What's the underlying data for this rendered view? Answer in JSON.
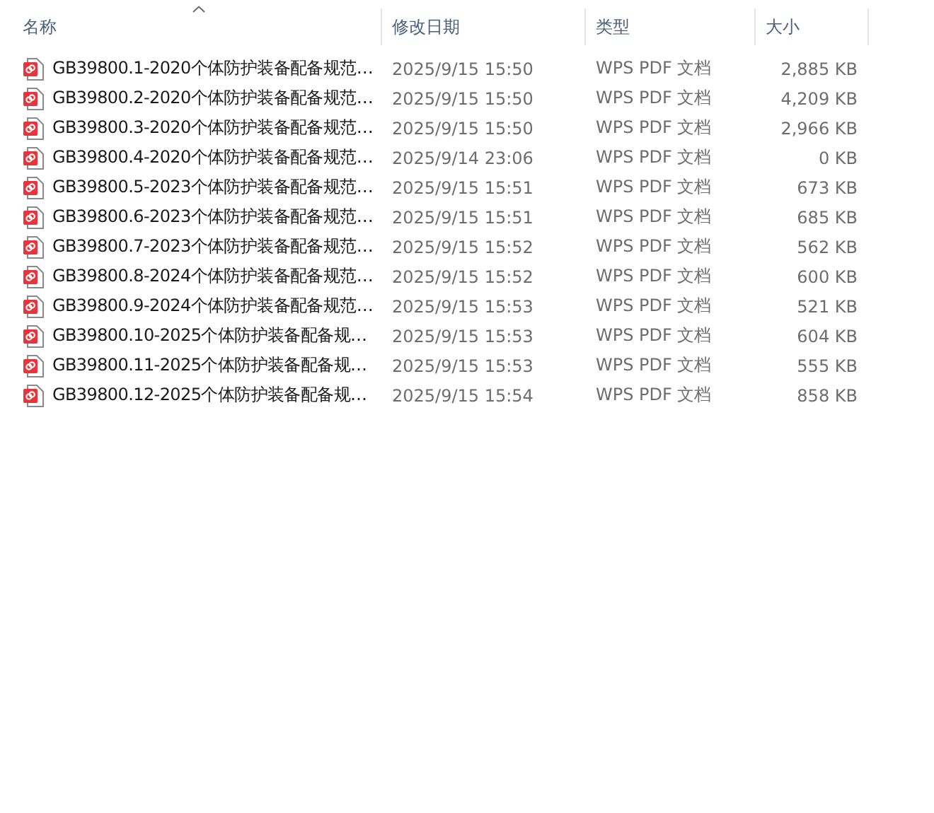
{
  "columns": [
    {
      "label": "名称",
      "sorted": true
    },
    {
      "label": "修改日期",
      "sorted": false
    },
    {
      "label": "类型",
      "sorted": false
    },
    {
      "label": "大小",
      "sorted": false
    }
  ],
  "files": [
    {
      "name": "GB39800.1-2020个体防护装备配备规范…",
      "modified": "2025/9/15 15:50",
      "type": "WPS PDF 文档",
      "size": "2,885 KB"
    },
    {
      "name": "GB39800.2-2020个体防护装备配备规范…",
      "modified": "2025/9/15 15:50",
      "type": "WPS PDF 文档",
      "size": "4,209 KB"
    },
    {
      "name": "GB39800.3-2020个体防护装备配备规范…",
      "modified": "2025/9/15 15:50",
      "type": "WPS PDF 文档",
      "size": "2,966 KB"
    },
    {
      "name": "GB39800.4-2020个体防护装备配备规范…",
      "modified": "2025/9/14 23:06",
      "type": "WPS PDF 文档",
      "size": "0 KB"
    },
    {
      "name": "GB39800.5-2023个体防护装备配备规范…",
      "modified": "2025/9/15 15:51",
      "type": "WPS PDF 文档",
      "size": "673 KB"
    },
    {
      "name": "GB39800.6-2023个体防护装备配备规范…",
      "modified": "2025/9/15 15:51",
      "type": "WPS PDF 文档",
      "size": "685 KB"
    },
    {
      "name": "GB39800.7-2023个体防护装备配备规范…",
      "modified": "2025/9/15 15:52",
      "type": "WPS PDF 文档",
      "size": "562 KB"
    },
    {
      "name": "GB39800.8-2024个体防护装备配备规范…",
      "modified": "2025/9/15 15:52",
      "type": "WPS PDF 文档",
      "size": "600 KB"
    },
    {
      "name": "GB39800.9-2024个体防护装备配备规范…",
      "modified": "2025/9/15 15:53",
      "type": "WPS PDF 文档",
      "size": "521 KB"
    },
    {
      "name": "GB39800.10-2025个体防护装备配备规…",
      "modified": "2025/9/15 15:53",
      "type": "WPS PDF 文档",
      "size": "604 KB"
    },
    {
      "name": "GB39800.11-2025个体防护装备配备规…",
      "modified": "2025/9/15 15:53",
      "type": "WPS PDF 文档",
      "size": "555 KB"
    },
    {
      "name": "GB39800.12-2025个体防护装备配备规…",
      "modified": "2025/9/15 15:54",
      "type": "WPS PDF 文档",
      "size": "858 KB"
    }
  ]
}
